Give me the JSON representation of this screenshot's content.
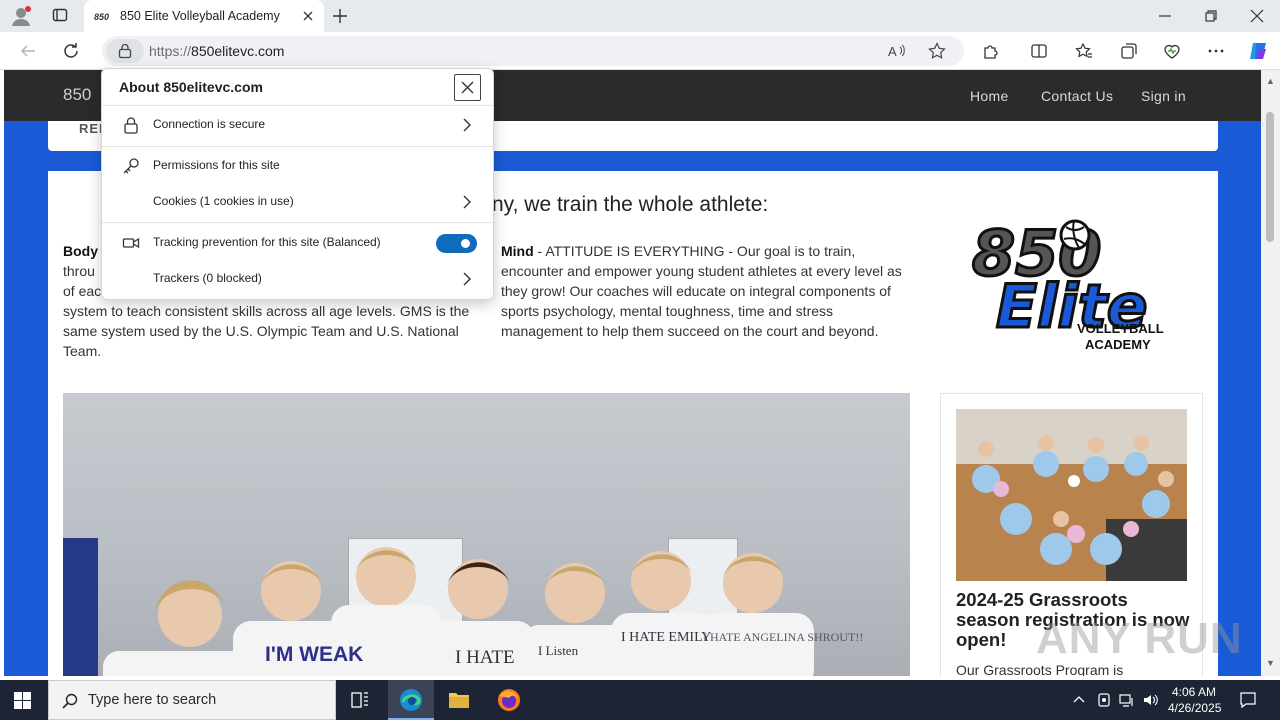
{
  "browser": {
    "tab_title": "850 Elite Volleyball Academy",
    "url_scheme": "https://",
    "url_host": "850elitevc.com"
  },
  "site": {
    "brand": "850",
    "nav": [
      "Home",
      "Contact Us",
      "Sign in"
    ],
    "subbar_text": "REI",
    "headline": "ny, we train the whole athlete:",
    "body_heading": "Body",
    "body_fragments": [
      "throu",
      "of eac"
    ],
    "body_lines": "system to teach consistent skills across all age levels. GMS is the same system used by the U.S. Olympic Team and U.S. National Team.",
    "mind_heading": "Mind",
    "mind_text": " - ATTITUDE IS EVERYTHING - Our goal is to train, encounter and empower young student athletes at every level as they grow! Our coaches will educate on integral components of sports psychology, mental toughness, time and stress management to help them succeed on the court and beyond.",
    "logo": {
      "number": "850",
      "word": "Elite",
      "line1": "VOLLEYBALL",
      "line2": "ACADEMY"
    },
    "shirt_texts": [
      "I'M WEAK",
      "I HATE",
      "I Listen",
      "I HATE EMILY",
      "I HATE ANGELINA SHROUT!!"
    ],
    "side_card": {
      "title": "2024-25 Grassroots season registration is now open!",
      "text": "Our Grassroots Program is"
    },
    "watermark": "ANY RUN"
  },
  "popup": {
    "title": "About 850elitevc.com",
    "rows": [
      {
        "label": "Connection is secure",
        "icon": "lock-icon"
      },
      {
        "label": "Permissions for this site",
        "icon": "key-icon"
      },
      {
        "label": "Cookies (1 cookies in use)",
        "icon": ""
      },
      {
        "label": "Tracking prevention for this site (Balanced)",
        "icon": "tracking-icon",
        "toggle_on": true
      },
      {
        "label": "Trackers (0 blocked)",
        "icon": ""
      }
    ]
  },
  "taskbar": {
    "search_placeholder": "Type here to search",
    "time": "4:06 AM",
    "date": "4/26/2025"
  },
  "colors": {
    "accent": "#0f6cbd",
    "site_blue": "#1a5ad6",
    "header_dark": "#2b2b2b"
  }
}
